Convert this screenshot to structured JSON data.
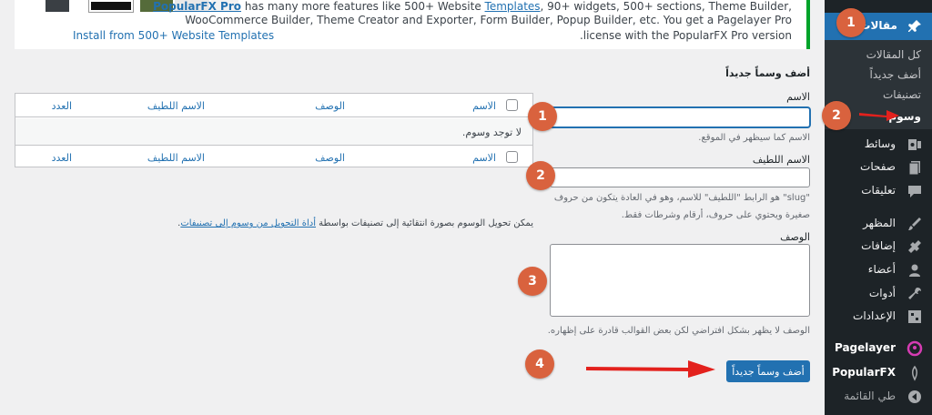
{
  "notice": {
    "line1_brand": "PopularFX Pro",
    "line1_mid": " has many more features like 500+ Website ",
    "line1_link": "Templates",
    "line1_end": ", 90+ widgets, 500+ sections, Theme Builder,",
    "line2": "WooCommerce Builder, Theme Creator and Exporter, Form Builder, Popup Builder, etc. You get a Pagelayer Pro",
    "line3": ".license with the PopularFX Pro version",
    "install_link": "Install from 500+ Website Templates"
  },
  "sidebar": {
    "posts_label": "مقالات",
    "submenu": {
      "all_posts": "كل المقالات",
      "add_new": "أضف جديداً",
      "categories": "تصنيفات",
      "tags": "وسوم"
    },
    "items": [
      {
        "label": "وسائط",
        "icon": "media-icon"
      },
      {
        "label": "صفحات",
        "icon": "pages-icon"
      },
      {
        "label": "تعليقات",
        "icon": "comments-icon"
      },
      {
        "label": "المظهر",
        "icon": "appearance-icon"
      },
      {
        "label": "إضافات",
        "icon": "plugins-icon"
      },
      {
        "label": "أعضاء",
        "icon": "users-icon"
      },
      {
        "label": "أدوات",
        "icon": "tools-icon"
      },
      {
        "label": "الإعدادات",
        "icon": "settings-icon"
      },
      {
        "label": "Pagelayer",
        "icon": "pagelayer-icon"
      },
      {
        "label": "PopularFX",
        "icon": "popularfx-icon"
      },
      {
        "label": "طي القائمة",
        "icon": "collapse-icon"
      }
    ]
  },
  "form": {
    "title": "أضف وسماً جديداً",
    "name_label": "الاسم",
    "name_help": "الاسم كما سيظهر في الموقع.",
    "slug_label": "الاسم اللطيف",
    "slug_help": "\"slug\" هو الرابط \"اللطيف\" للاسم، وهو في العادة يتكون من حروف صغيرة ويحتوي على حروف، أرقام وشرطات فقط.",
    "desc_label": "الوصف",
    "desc_help": "الوصف لا يظهر بشكل افتراضي لكن بعض القوالب قادرة على إظهاره.",
    "submit_label": "أضف وسماً جديداً"
  },
  "table": {
    "columns": [
      "الاسم",
      "الوصف",
      "الاسم اللطيف",
      "العدد"
    ],
    "empty_text": "لا توجد وسوم."
  },
  "convert_note": {
    "text": "يمكن تحويل الوسوم بصورة انتقائية إلى تصنيفات بواسطة ",
    "link": "أداة التحويل من وسوم إلى تصنيفات",
    "end": "."
  },
  "badges": {
    "b1": "1",
    "b2": "2",
    "f1": "1",
    "f2": "2",
    "f3": "3",
    "f4": "4"
  },
  "colors": {
    "accent": "#2271b1",
    "sidebar": "#1d2327",
    "badge": "#d9623e",
    "arrow": "#e3211d",
    "notice_border": "#00a32a"
  }
}
